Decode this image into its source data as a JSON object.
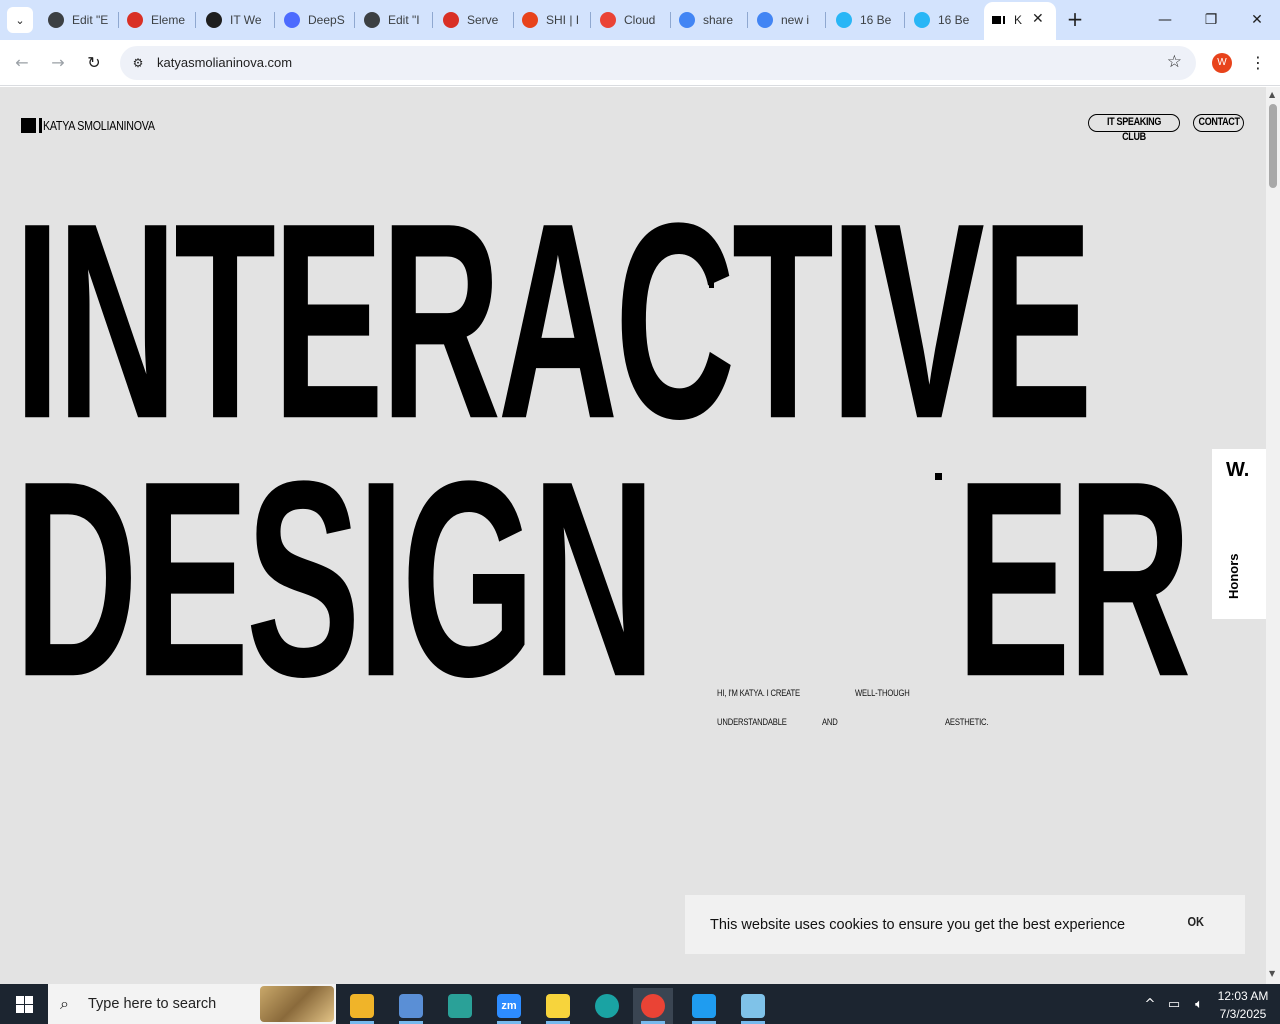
{
  "browser": {
    "tabs": [
      {
        "title": "Edit \"E",
        "icon": "wordpress-icon",
        "color": "#3c4043"
      },
      {
        "title": "Eleme",
        "icon": "elementor-icon",
        "color": "#d93025"
      },
      {
        "title": "IT We",
        "icon": "target-icon",
        "color": "#1f1f1f"
      },
      {
        "title": "DeepS",
        "icon": "deepseek-icon",
        "color": "#4d6bfe"
      },
      {
        "title": "Edit \"I",
        "icon": "wordpress-icon",
        "color": "#3c4043"
      },
      {
        "title": "Serve",
        "icon": "server-icon",
        "color": "#d93025"
      },
      {
        "title": "SHI | I",
        "icon": "ring-icon",
        "color": "#e8431b"
      },
      {
        "title": "Cloud",
        "icon": "cloud-icon",
        "color": "#ea4335"
      },
      {
        "title": "share",
        "icon": "google-icon",
        "color": "#4285f4"
      },
      {
        "title": "new i",
        "icon": "google-icon",
        "color": "#4285f4"
      },
      {
        "title": "16 Be",
        "icon": "download-icon",
        "color": "#29b6f6"
      },
      {
        "title": "16 Be",
        "icon": "download-icon",
        "color": "#29b6f6"
      }
    ],
    "active_tab": {
      "title": "K",
      "close": "✕"
    },
    "new_tab": "+",
    "window_controls": {
      "minimize": "—",
      "restore": "❐",
      "close": "✕"
    },
    "url": "katyasmolianinova.com",
    "profile_initial": "W",
    "nav": {
      "back": "←",
      "forward": "→",
      "reload": "↻"
    }
  },
  "site": {
    "logo_name": "KATYA SMOLIANINOVA",
    "nav": [
      {
        "label": "IT SPEAKING CLUB"
      },
      {
        "label": "CONTACT"
      }
    ],
    "hero": {
      "line1": "INTERACTIVE",
      "line2_left": "DESIGN",
      "line2_right": "ER"
    },
    "intro": {
      "a": "HI, I'M KATYA. I CREATE",
      "b": "WELL-THOUGH",
      "c": "UNDERSTANDABLE",
      "d": "AND",
      "e": "AESTHETIC."
    },
    "honors": {
      "badge": "W.",
      "label": "Honors"
    },
    "cookie": {
      "message": "This website uses cookies to ensure you get the best experience",
      "ok": "OK"
    },
    "background": "#e3e3e3"
  },
  "taskbar": {
    "search_placeholder": "Type here to search",
    "apps": [
      {
        "name": "file-explorer",
        "color": "#f0b429"
      },
      {
        "name": "paint",
        "color": "#5a8fd6"
      },
      {
        "name": "app-diamond",
        "color": "#2aa198"
      },
      {
        "name": "zoom",
        "color": "#2d8cff",
        "label": "zm"
      },
      {
        "name": "sticky-notes",
        "color": "#f7d43c"
      },
      {
        "name": "edge",
        "color": "#1aa3a3"
      },
      {
        "name": "chrome",
        "color": "#ea4335"
      },
      {
        "name": "vscode",
        "color": "#1f9cf0"
      },
      {
        "name": "notepad",
        "color": "#7fc2e8"
      }
    ],
    "time": "12:03 AM",
    "date": "7/3/2025"
  }
}
